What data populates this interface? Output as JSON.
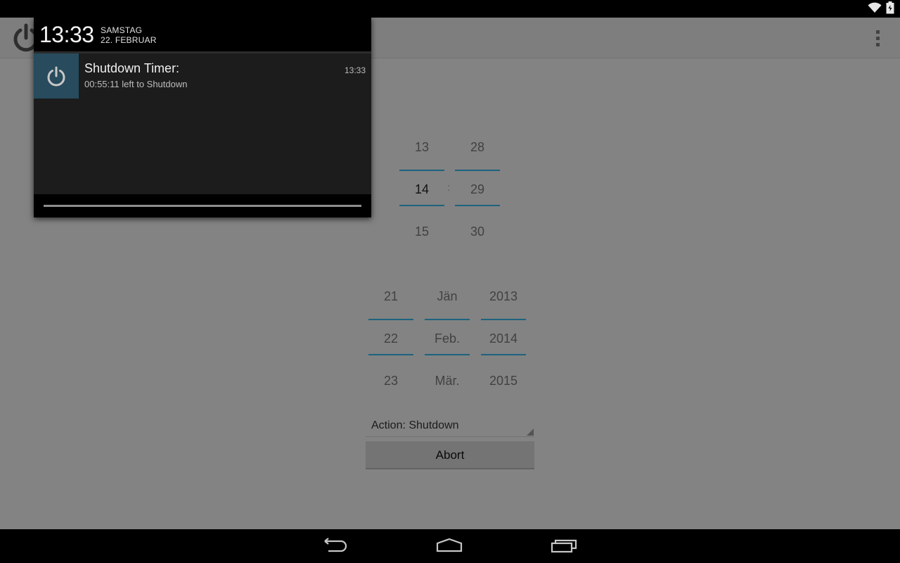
{
  "status_bar": {
    "icons": [
      "wifi-icon",
      "battery-icon"
    ]
  },
  "app": {
    "overflow_icon": "overflow-menu-icon",
    "time_picker": {
      "hour": {
        "prev": "13",
        "current": "14",
        "next": "15"
      },
      "separator": ":",
      "minute": {
        "prev": "28",
        "current": "29",
        "next": "30"
      }
    },
    "date_picker": {
      "day": {
        "prev": "21",
        "current": "22",
        "next": "23"
      },
      "month": {
        "prev": "Jän",
        "current": "Feb.",
        "next": "Mär."
      },
      "year": {
        "prev": "2013",
        "current": "2014",
        "next": "2015"
      }
    },
    "action_label": "Action: Shutdown",
    "abort_label": "Abort"
  },
  "shade": {
    "clock": "13:33",
    "day": "SAMSTAG",
    "date": "22. FEBRUAR",
    "notification": {
      "title": "Shutdown Timer:",
      "text": "00:55:11 left to Shutdown",
      "time": "13:33"
    }
  },
  "colors": {
    "accent": "#33b5e5",
    "notification_icon_bg": "#284b5d"
  },
  "nav_bar": {
    "buttons": [
      "back-icon",
      "home-icon",
      "recent-apps-icon"
    ]
  }
}
